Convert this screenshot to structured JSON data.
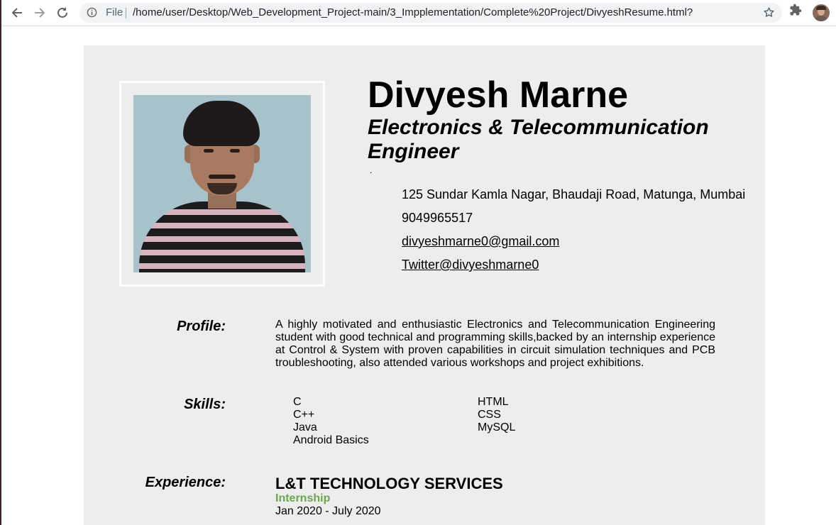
{
  "browser": {
    "scheme_label": "File",
    "url": "/home/user/Desktop/Web_Development_Project-main/3_Impplementation/Complete%20Project/DivyeshResume.html?",
    "icons": [
      "back-arrow-icon",
      "forward-arrow-icon",
      "reload-icon",
      "info-icon",
      "star-icon",
      "extensions-puzzle-icon",
      "profile-avatar"
    ]
  },
  "resume": {
    "name": "Divyesh Marne",
    "title": "Electronics & Telecommunication Engineer",
    "dot": ".",
    "address": "125 Sundar Kamla Nagar, Bhaudaji Road, Matunga, Mumbai",
    "phone": "9049965517",
    "email": "divyeshmarne0@gmail.com",
    "twitter": "Twitter@divyeshmarne0",
    "profile": {
      "label": "Profile:",
      "text": "A highly motivated and enthusiastic Electronics and Telecommunication Engineering student with good technical and programming skills,backed by an internship experience at Control & System with proven capabilities in circuit simulation techniques and PCB troubleshooting, also attended various workshops and project exhibitions."
    },
    "skills": {
      "label": "Skills:",
      "column1": [
        "C",
        "C++",
        "Java",
        "Android Basics"
      ],
      "column2": [
        "HTML",
        "CSS",
        "MySQL"
      ]
    },
    "experience": {
      "label": "Experience:",
      "company": "L&T TECHNOLOGY SERVICES",
      "role": "Internship",
      "dates": "Jan 2020 - July 2020"
    }
  },
  "colors": {
    "page_background": "#ededed",
    "role_green": "#6aa84f",
    "omnibox": "#f1f3f4"
  }
}
